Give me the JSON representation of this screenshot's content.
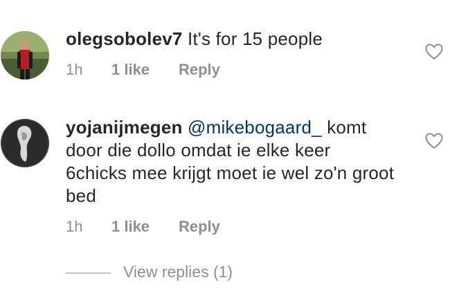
{
  "comments": [
    {
      "username": "olegsobolev7",
      "mention": "",
      "text": " It's for 15 people",
      "time": "1h",
      "likes": "1 like",
      "reply_label": "Reply",
      "like_icon": "heart-outline-icon"
    },
    {
      "username": "yojanijmegen",
      "mention": "@mikebogaard_",
      "text": "  komt door die dollo omdat ie elke keer 6chicks mee krijgt moet ie wel zo'n groot bed",
      "time": "1h",
      "likes": "1 like",
      "reply_label": "Reply",
      "like_icon": "heart-outline-icon"
    }
  ],
  "view_replies_label": "View replies (1)",
  "colors": {
    "text": "#262626",
    "muted": "#8e8e8e",
    "mention": "#003569"
  }
}
